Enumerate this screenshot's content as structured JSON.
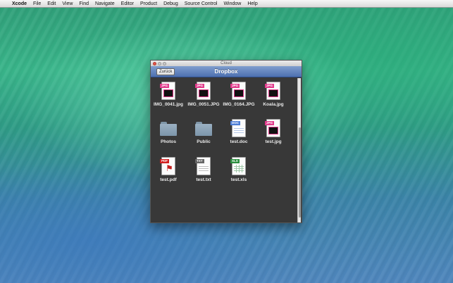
{
  "menubar": {
    "apple_icon": "apple-icon",
    "app_name": "Xcode",
    "items": [
      "File",
      "Edit",
      "View",
      "Find",
      "Navigate",
      "Editor",
      "Product",
      "Debug",
      "Source Control",
      "Window",
      "Help"
    ]
  },
  "window": {
    "title": "Cloud",
    "nav": {
      "title": "Dropbox",
      "back_label": "Zurück"
    },
    "files": [
      {
        "name": "IMG_0041.jpg",
        "type": "jpg",
        "badge": "JPG"
      },
      {
        "name": "IMG_0051.JPG",
        "type": "jpg",
        "badge": "JPG"
      },
      {
        "name": "IMG_0164.JPG",
        "type": "jpg",
        "badge": "JPG"
      },
      {
        "name": "Koala.jpg",
        "type": "jpg",
        "badge": "JPG"
      },
      {
        "name": "Photos",
        "type": "folder"
      },
      {
        "name": "Public",
        "type": "folder"
      },
      {
        "name": "test.doc",
        "type": "doc",
        "badge": "DOC"
      },
      {
        "name": "test.jpg",
        "type": "jpg",
        "badge": "JPG"
      },
      {
        "name": "test.pdf",
        "type": "pdf",
        "badge": "PDF"
      },
      {
        "name": "test.txt",
        "type": "txt",
        "badge": "TXT"
      },
      {
        "name": "test.xls",
        "type": "xls",
        "badge": "XLS"
      }
    ]
  },
  "colors": {
    "nav_bar": "#4d70b0",
    "content_bg": "#383838",
    "jpg_badge": "#e23b8c",
    "pdf_badge": "#d32020",
    "doc_badge": "#4d7ed6",
    "xls_badge": "#2a8f3d"
  }
}
